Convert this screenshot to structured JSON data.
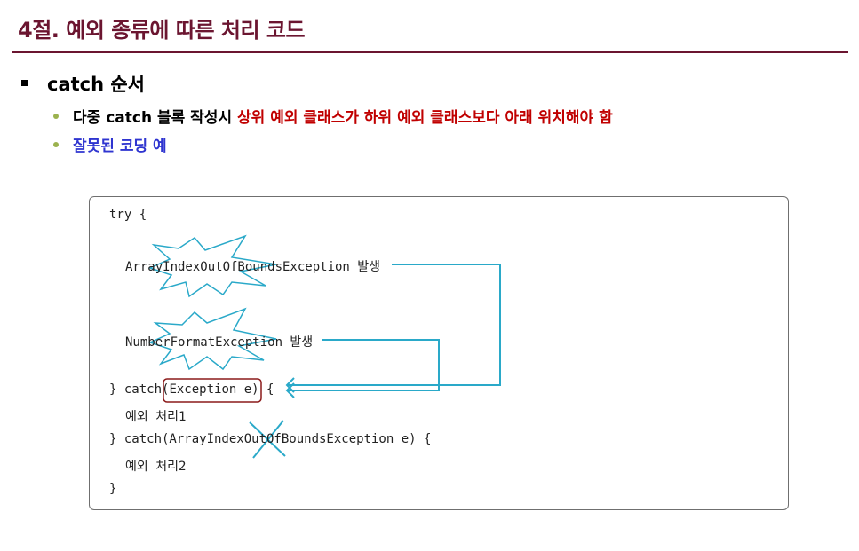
{
  "title": "4절. 예외 종류에 따른 처리 코드",
  "bullet": "catch 순서",
  "sub1": {
    "text_black": "다중 catch 블록 작성시 ",
    "text_red": "상위 예외 클래스가 하위 예외 클래스보다 아래 위치해야 함"
  },
  "sub2": "잘못된 코딩 예",
  "code": {
    "try_open": "try {",
    "ex1": "ArrayIndexOutOfBoundsException 발생",
    "ex2": "NumberFormatException 발생",
    "catch1_a": "} catch",
    "catch1_b": "(Exception e)",
    "catch1_c": " {",
    "handle1": "예외 처리1",
    "catch2": "} catch(ArrayIndexOutOfBoundsException e) {",
    "handle2": "예외 처리2",
    "close": "}"
  },
  "colors": {
    "title": "#6b1530",
    "red": "#c00000",
    "blue": "#2f35d0",
    "bullet_dot": "#9bb24e",
    "arrow": "#2aa9c9",
    "highlight_box": "#8b1a1a"
  }
}
